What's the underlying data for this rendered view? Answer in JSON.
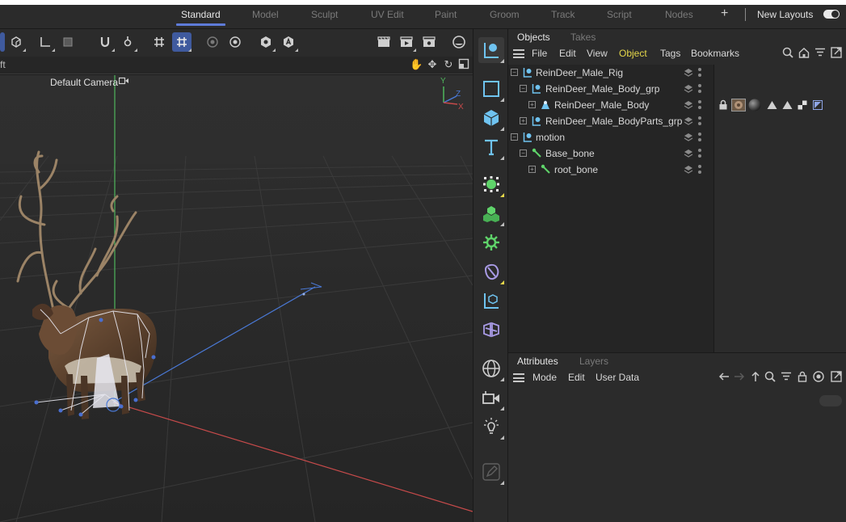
{
  "layout_bar": {
    "tabs": [
      "Standard",
      "Model",
      "Sculpt",
      "UV Edit",
      "Paint",
      "Groom",
      "Track",
      "Script",
      "Nodes"
    ],
    "active_tab": "Standard",
    "plus_label": "+",
    "new_layouts_label": "New Layouts",
    "toggle_on": true
  },
  "viewport": {
    "header_label": "ft",
    "camera_label": "Default Camera",
    "axis_labels": {
      "y": "Y",
      "z": "Z",
      "x": "X"
    },
    "colors": {
      "background": "#2e2e2e",
      "x_axis": "#c64a4a",
      "y_axis": "#4fb65c",
      "z_axis": "#4a79d6"
    }
  },
  "objects_panel": {
    "tabs": [
      "Objects",
      "Takes"
    ],
    "active_tab": "Objects",
    "menu": [
      "File",
      "Edit",
      "View",
      "Object",
      "Tags",
      "Bookmarks"
    ],
    "active_menu": "Object",
    "tree": [
      {
        "name": "ReinDeer_Male_Rig",
        "icon": "null-object-icon"
      },
      {
        "name": "ReinDeer_Male_Body_grp",
        "icon": "null-object-icon"
      },
      {
        "name": "ReinDeer_Male_Body",
        "icon": "polygon-mesh-icon"
      },
      {
        "name": "ReinDeer_Male_BodyParts_grp",
        "icon": "null-object-icon"
      },
      {
        "name": "motion",
        "icon": "null-object-icon"
      },
      {
        "name": "Base_bone",
        "icon": "joint-icon"
      },
      {
        "name": "root_bone",
        "icon": "joint-icon"
      }
    ]
  },
  "attributes_panel": {
    "tabs": [
      "Attributes",
      "Layers"
    ],
    "active_tab": "Attributes",
    "menu": [
      "Mode",
      "Edit",
      "User Data"
    ]
  },
  "colors": {
    "accent": "#5e7bd8",
    "active_menu": "#e5d74a",
    "selection": "#3f5a9e",
    "icon_blue": "#6fc3f0",
    "icon_green": "#5fd36a",
    "icon_purple": "#a99be6"
  }
}
